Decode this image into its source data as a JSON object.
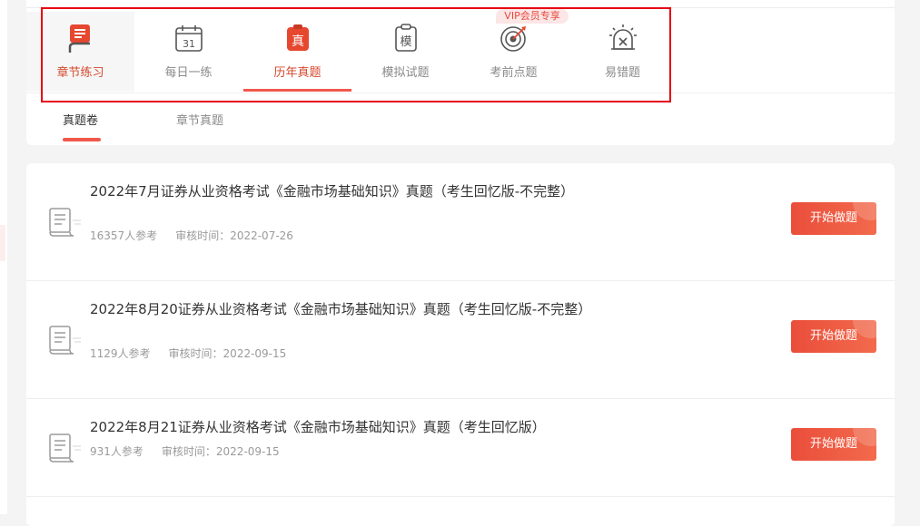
{
  "categories": [
    {
      "label": "章节练习",
      "icon": "chapter-book-icon",
      "state": "soft"
    },
    {
      "label": "每日一练",
      "icon": "calendar-icon",
      "state": "normal",
      "calendar_day": "31"
    },
    {
      "label": "历年真题",
      "icon": "real-exam-icon",
      "state": "active",
      "icon_text": "真"
    },
    {
      "label": "模拟试题",
      "icon": "mock-exam-icon",
      "state": "normal",
      "icon_text": "模"
    },
    {
      "label": "考前点题",
      "icon": "target-icon",
      "state": "normal"
    },
    {
      "label": "易错题",
      "icon": "alarm-icon",
      "state": "normal"
    }
  ],
  "vip_badge": "VIP会员专享",
  "subtabs": [
    "真题卷",
    "章节真题"
  ],
  "papers": [
    {
      "title": "2022年7月证券从业资格考试《金融市场基础知识》真题（考生回忆版-不完整）",
      "participants": "16357人参考",
      "review_time": "审核时间：2022-07-26",
      "button": "开始做题"
    },
    {
      "title": "2022年8月20证券从业资格考试《金融市场基础知识》真题（考生回忆版-不完整）",
      "participants": "1129人参考",
      "review_time": "审核时间：2022-09-15",
      "button": "开始做题"
    },
    {
      "title": "2022年8月21证券从业资格考试《金融市场基础知识》真题（考生回忆版）",
      "participants": "931人参考",
      "review_time": "审核时间：2022-09-15",
      "button": "开始做题"
    }
  ],
  "colors": {
    "accent": "#f0584c",
    "active_text": "#d5492c",
    "highlight_border": "#e60012",
    "button": "#ea4e3b"
  }
}
